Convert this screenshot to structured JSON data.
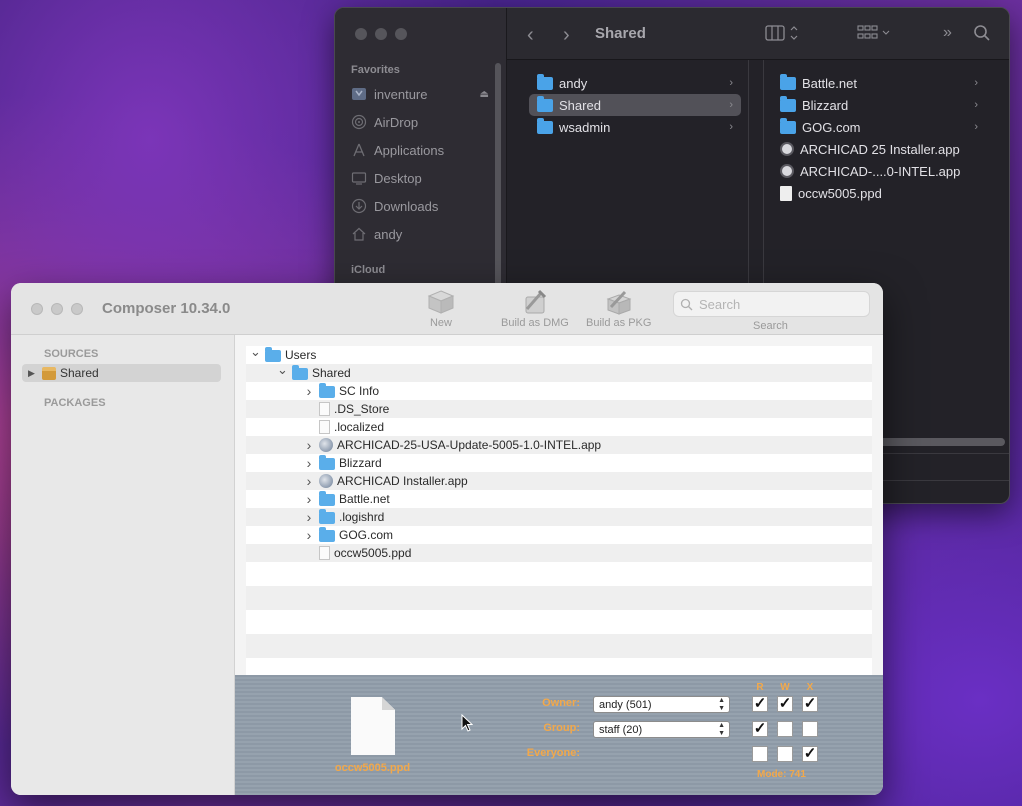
{
  "finder": {
    "title": "Shared",
    "sidebar": {
      "favorites_label": "Favorites",
      "items": [
        {
          "label": "inventure",
          "icon": "disk-icon"
        },
        {
          "label": "AirDrop",
          "icon": "airdrop-icon"
        },
        {
          "label": "Applications",
          "icon": "applications-icon"
        },
        {
          "label": "Desktop",
          "icon": "desktop-icon"
        },
        {
          "label": "Downloads",
          "icon": "downloads-icon"
        },
        {
          "label": "andy",
          "icon": "home-icon"
        }
      ],
      "icloud_label": "iCloud"
    },
    "column1": [
      {
        "label": "andy",
        "selected": false
      },
      {
        "label": "Shared",
        "selected": true
      },
      {
        "label": "wsadmin",
        "selected": false
      }
    ],
    "column2": [
      {
        "label": "Battle.net",
        "kind": "folder"
      },
      {
        "label": "Blizzard",
        "kind": "folder"
      },
      {
        "label": "GOG.com",
        "kind": "folder"
      },
      {
        "label": "ARCHICAD 25 Installer.app",
        "kind": "app"
      },
      {
        "label": "ARCHICAD-....0-INTEL.app",
        "kind": "app"
      },
      {
        "label": "occw5005.ppd",
        "kind": "file"
      }
    ]
  },
  "composer": {
    "title": "Composer 10.34.0",
    "toolbar": {
      "new_label": "New",
      "build_dmg_label": "Build as DMG",
      "build_pkg_label": "Build as PKG",
      "search_placeholder": "Search",
      "search_label": "Search"
    },
    "sidebar": {
      "sources_label": "SOURCES",
      "source_item": "Shared",
      "packages_label": "PACKAGES"
    },
    "tree": [
      {
        "label": "Users",
        "indent": 0,
        "expander": "open",
        "kind": "folder"
      },
      {
        "label": "Shared",
        "indent": 1,
        "expander": "open",
        "kind": "folder"
      },
      {
        "label": "SC Info",
        "indent": 2,
        "expander": "closed",
        "kind": "folder"
      },
      {
        "label": ".DS_Store",
        "indent": 2,
        "expander": "none",
        "kind": "file"
      },
      {
        "label": ".localized",
        "indent": 2,
        "expander": "none",
        "kind": "file"
      },
      {
        "label": "ARCHICAD-25-USA-Update-5005-1.0-INTEL.app",
        "indent": 2,
        "expander": "closed",
        "kind": "app"
      },
      {
        "label": "Blizzard",
        "indent": 2,
        "expander": "closed",
        "kind": "folder"
      },
      {
        "label": "ARCHICAD Installer.app",
        "indent": 2,
        "expander": "closed",
        "kind": "app"
      },
      {
        "label": "Battle.net",
        "indent": 2,
        "expander": "closed",
        "kind": "folder"
      },
      {
        "label": ".logishrd",
        "indent": 2,
        "expander": "closed",
        "kind": "folder"
      },
      {
        "label": "GOG.com",
        "indent": 2,
        "expander": "closed",
        "kind": "folder"
      },
      {
        "label": "occw5005.ppd",
        "indent": 2,
        "expander": "none",
        "kind": "file"
      }
    ],
    "info": {
      "filename": "occw5005.ppd",
      "owner_label": "Owner:",
      "owner_value": "andy (501)",
      "group_label": "Group:",
      "group_value": "staff (20)",
      "everyone_label": "Everyone:",
      "r_label": "R",
      "w_label": "W",
      "x_label": "X",
      "permissions": {
        "owner": [
          true,
          true,
          true
        ],
        "group": [
          true,
          false,
          false
        ],
        "everyone": [
          false,
          false,
          true
        ]
      },
      "mode": "Mode: 741"
    }
  },
  "colors": {
    "accent_orange": "#f2a84a",
    "finder_folder": "#4aa3e8",
    "composer_folder": "#5aaeea"
  }
}
